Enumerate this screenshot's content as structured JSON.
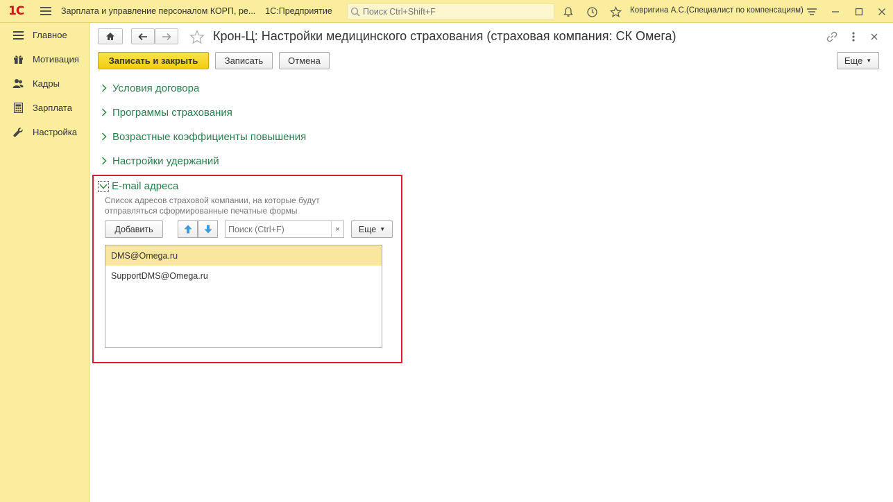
{
  "titlebar": {
    "logo": "1С",
    "app_title": "Зарплата и управление персоналом КОРП, ре...",
    "platform": "1С:Предприятие",
    "search_placeholder": "Поиск Ctrl+Shift+F",
    "user": "Ковригина А.С.(Специалист по компенсациям)"
  },
  "sidebar": {
    "items": [
      {
        "label": "Главное",
        "icon": "menu-lines-icon"
      },
      {
        "label": "Мотивация",
        "icon": "gift-icon"
      },
      {
        "label": "Кадры",
        "icon": "people-icon"
      },
      {
        "label": "Зарплата",
        "icon": "calculator-icon"
      },
      {
        "label": "Настройка",
        "icon": "wrench-icon"
      }
    ]
  },
  "main": {
    "title": "Крон-Ц: Настройки медицинского страхования (страховая компания: СК Омега)",
    "toolbar": {
      "save_close": "Записать и закрыть",
      "save": "Записать",
      "cancel": "Отмена",
      "more": "Еще"
    },
    "groups": [
      {
        "label": "Условия договора"
      },
      {
        "label": "Программы страхования"
      },
      {
        "label": "Возрастные коэффициенты повышения"
      },
      {
        "label": "Настройки удержаний"
      }
    ],
    "email_section": {
      "title": "E-mail адреса",
      "description": "Список адресов страховой компании, на которые будут отправляться сформированные печатные формы",
      "add": "Добавить",
      "search_placeholder": "Поиск (Ctrl+F)",
      "clear": "×",
      "more": "Еще",
      "emails": [
        "DMS@Omega.ru",
        "SupportDMS@Omega.ru"
      ],
      "selected_index": 0
    }
  },
  "colors": {
    "panel": "#fbed9e",
    "primary_button": "#f5d31e",
    "group_text": "#2a7d4c",
    "highlight_border": "#d2232a",
    "selected_row": "#fae79f"
  }
}
